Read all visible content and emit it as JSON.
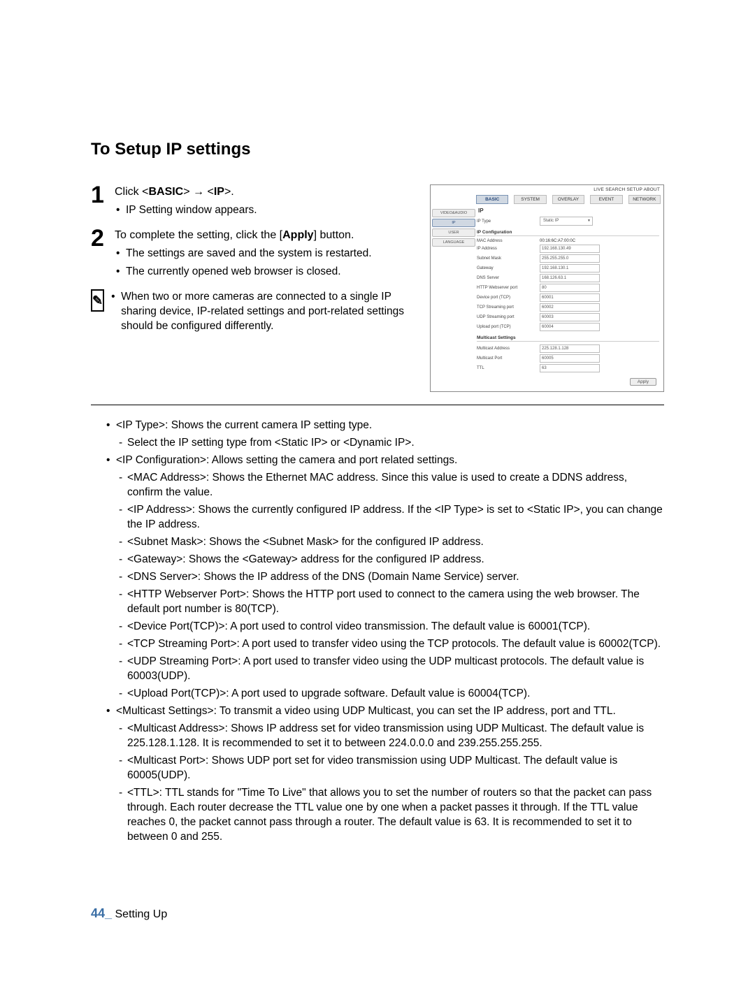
{
  "heading": "To Setup IP settings",
  "steps": [
    {
      "num": "1",
      "line_a": "Click <",
      "line_b": "BASIC",
      "line_c": "> → <",
      "line_d": "IP",
      "line_e": ">.",
      "subs": [
        "IP Setting window appears."
      ]
    },
    {
      "num": "2",
      "line": "To complete the setting, click the [",
      "bold": "Apply",
      "line_end": "] button.",
      "subs": [
        "The settings are saved and the system is restarted.",
        "The currently opened web browser is closed."
      ]
    }
  ],
  "note_icon": "✎",
  "note": "When two or more cameras are connected to a single IP sharing device, IP-related settings and port-related settings should be configured differently.",
  "defs": [
    {
      "lv": 1,
      "t": "<IP Type>: Shows the current camera IP setting type."
    },
    {
      "lv": 2,
      "t": "Select the IP setting type from <Static IP> or <Dynamic IP>."
    },
    {
      "lv": 1,
      "t": "<IP Configuration>: Allows setting the camera and port related settings."
    },
    {
      "lv": 2,
      "t": "<MAC Address>: Shows the Ethernet MAC address. Since this value is used to create a DDNS address, confirm the value."
    },
    {
      "lv": 2,
      "t": "<IP Address>: Shows the currently configured IP address. If the <IP Type> is set to <Static IP>, you can change the IP address."
    },
    {
      "lv": 2,
      "t": "<Subnet Mask>: Shows the <Subnet Mask> for the configured IP address."
    },
    {
      "lv": 2,
      "t": "<Gateway>: Shows the <Gateway> address for the configured IP address."
    },
    {
      "lv": 2,
      "t": "<DNS Server>: Shows the IP address of the DNS (Domain Name Service) server."
    },
    {
      "lv": 2,
      "t": "<HTTP Webserver Port>: Shows the HTTP port used to connect to the camera using the web browser. The default port number is 80(TCP)."
    },
    {
      "lv": 2,
      "t": "<Device Port(TCP)>: A port used to control video transmission. The default value is 60001(TCP)."
    },
    {
      "lv": 2,
      "t": "<TCP Streaming Port>: A port used to transfer video using the TCP protocols. The default value is 60002(TCP)."
    },
    {
      "lv": 2,
      "t": "<UDP Streaming Port>: A port used to transfer video using the UDP multicast protocols. The default value is 60003(UDP)."
    },
    {
      "lv": 2,
      "t": "<Upload Port(TCP)>: A port used to upgrade software. Default value is 60004(TCP)."
    },
    {
      "lv": 1,
      "t": "<Multicast Settings>: To transmit a video using UDP Multicast, you can set the IP address, port and TTL."
    },
    {
      "lv": 2,
      "t": "<Multicast Address>: Shows IP address set for video transmission using UDP Multicast. The default value is 225.128.1.128. It is recommended to set it to between 224.0.0.0 and 239.255.255.255."
    },
    {
      "lv": 2,
      "t": "<Multicast Port>: Shows UDP port set for video transmission using UDP Multicast. The default value is 60005(UDP)."
    },
    {
      "lv": 2,
      "t": "<TTL>: TTL stands for \"Time To Live\" that allows you to set the number of routers so that the packet can pass through. Each router decrease the TTL value one by one when a packet passes it through. If the TTL value reaches 0, the packet cannot pass through a router. The default value is 63. It is recommended to set it to between 0 and 255."
    }
  ],
  "footer": {
    "page": "44_",
    "section": "Setting Up"
  },
  "screenshot": {
    "top_links": "LIVE  SEARCH  SETUP  ABOUT",
    "tabs": [
      "BASIC",
      "SYSTEM",
      "OVERLAY",
      "EVENT",
      "NETWORK"
    ],
    "active_tab": 0,
    "sidebar": [
      "VIDEO&AUDIO",
      "IP",
      "USER",
      "LANGUAGE"
    ],
    "active_side": 1,
    "title": "IP",
    "ip_type_label": "IP Type",
    "ip_type_value": "Static IP",
    "config_title": "IP Configuration",
    "config_rows": [
      {
        "label": "MAC Address",
        "value": "00:16:6C:A7:00:0C",
        "readonly": true
      },
      {
        "label": "IP Address",
        "value": "192.168.130.49"
      },
      {
        "label": "Subnet Mask",
        "value": "255.255.255.0"
      },
      {
        "label": "Gateway",
        "value": "192.168.130.1"
      },
      {
        "label": "DNS Server",
        "value": "168.126.63.1"
      },
      {
        "label": "HTTP Webserver port",
        "value": "80"
      },
      {
        "label": "Device port (TCP)",
        "value": "60001"
      },
      {
        "label": "TCP Streaming port",
        "value": "60002"
      },
      {
        "label": "UDP Streaming port",
        "value": "60003"
      },
      {
        "label": "Upload port (TCP)",
        "value": "60004"
      }
    ],
    "multicast_title": "Multicast Settings",
    "multicast_rows": [
      {
        "label": "Multicast Address",
        "value": "225.128.1.128"
      },
      {
        "label": "Multicast Port",
        "value": "60005"
      },
      {
        "label": "TTL",
        "value": "63"
      }
    ],
    "apply_label": "Apply"
  }
}
